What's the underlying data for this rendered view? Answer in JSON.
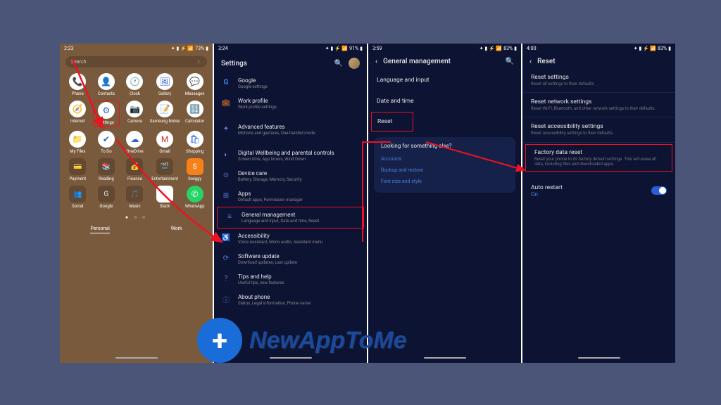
{
  "watermark": {
    "text": "NewAppToMe"
  },
  "screen1": {
    "time": "2:23",
    "battery": "73%",
    "search_placeholder": "Search",
    "apps_r1": [
      "Phone",
      "Contacts",
      "Clock",
      "Gallery",
      "Messages"
    ],
    "apps_r2": [
      "Internet",
      "Settings",
      "Camera",
      "Samsung Notes",
      "Calculator"
    ],
    "apps_r3": [
      "My Files",
      "To Do",
      "OneDrive",
      "Gmail",
      "Shopping"
    ],
    "apps_r4": [
      "Payment",
      "Reading",
      "Finance",
      "Entertainment",
      "Swiggy"
    ],
    "apps_r5": [
      "Social",
      "Google",
      "Music",
      "Slack",
      "WhatsApp"
    ],
    "tabs": {
      "personal": "Personal",
      "work": "Work"
    }
  },
  "screen2": {
    "time": "3:24",
    "battery": "91%",
    "title": "Settings",
    "items": [
      {
        "icon": "G",
        "title": "Google",
        "sub": "Google settings"
      },
      {
        "icon": "💼",
        "title": "Work profile",
        "sub": "Work profile settings"
      },
      {
        "icon": "✦",
        "title": "Advanced features",
        "sub": "Motions and gestures, One-handed mode"
      },
      {
        "icon": "◐",
        "title": "Digital Wellbeing and parental controls",
        "sub": "Screen time, App timers, Wind Down"
      },
      {
        "icon": "⊙",
        "title": "Device care",
        "sub": "Battery, Storage, Memory, Security"
      },
      {
        "icon": "⊞",
        "title": "Apps",
        "sub": "Default apps, Permission manager"
      },
      {
        "icon": "≡",
        "title": "General management",
        "sub": "Language and input, Date and time, Reset"
      },
      {
        "icon": "♿",
        "title": "Accessibility",
        "sub": "Voice Assistant, Mono audio, Assistant menu"
      },
      {
        "icon": "⟳",
        "title": "Software update",
        "sub": "Download updates, Last update"
      },
      {
        "icon": "?",
        "title": "Tips and help",
        "sub": "Useful tips, new features"
      },
      {
        "icon": "ⓘ",
        "title": "About phone",
        "sub": "Status, Legal information, Phone name"
      }
    ]
  },
  "screen3": {
    "time": "3:59",
    "battery": "83%",
    "title": "General management",
    "rows": [
      "Language and input",
      "Date and time",
      "Reset"
    ],
    "panel_title": "Looking for something else?",
    "panel_links": [
      "Accounts",
      "Backup and restore",
      "Font size and style"
    ]
  },
  "screen4": {
    "time": "4:00",
    "battery": "83%",
    "title": "Reset",
    "items": [
      {
        "title": "Reset settings",
        "sub": "Reset all settings to their defaults."
      },
      {
        "title": "Reset network settings",
        "sub": "Reset Wi-Fi, Bluetooth, and other network settings to their defaults."
      },
      {
        "title": "Reset accessibility settings",
        "sub": "Reset accessibility settings to their defaults."
      },
      {
        "title": "Factory data reset",
        "sub": "Reset your phone to its factory default settings. This will erase all data, including files and downloaded apps."
      }
    ],
    "auto_restart": {
      "label": "Auto restart",
      "state": "On"
    }
  }
}
